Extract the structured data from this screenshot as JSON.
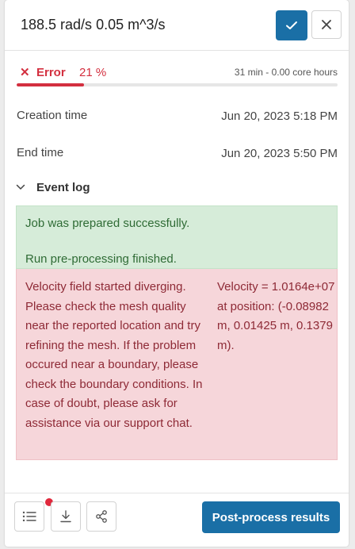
{
  "header": {
    "title": "188.5 rad/s 0.05 m^3/s",
    "confirm_icon": "check-icon",
    "close_icon": "close-icon"
  },
  "status": {
    "icon": "error-x-icon",
    "label": "Error",
    "percent_text": "21 %",
    "progress": 0.21,
    "duration": "31 min - 0.00 core hours",
    "color": "#d32f3f"
  },
  "meta": {
    "creation_label": "Creation time",
    "creation_value": "Jun 20, 2023 5:18 PM",
    "end_label": "End time",
    "end_value": "Jun 20, 2023 5:50 PM"
  },
  "event_log": {
    "label": "Event log",
    "toggle_icon": "chevron-down-icon",
    "success_entries": [
      "Job was prepared successfully.",
      "Run pre-processing finished."
    ],
    "error_entry": {
      "message": "Velocity field started diverging. Please check the mesh quality near the reported location and try refining the mesh. If the problem occured near a boundary, please check the boundary conditions. In case of doubt, please ask for assistance via our support chat.",
      "detail": "Velocity = 1.0164e+07 at position: (-0.08982 m, 0.01425 m, 0.1379 m)."
    }
  },
  "footer": {
    "list_icon": "list-icon",
    "download_icon": "download-icon",
    "share_icon": "share-icon",
    "post_process_label": "Post-process results",
    "accent": "#1a6fa6"
  }
}
